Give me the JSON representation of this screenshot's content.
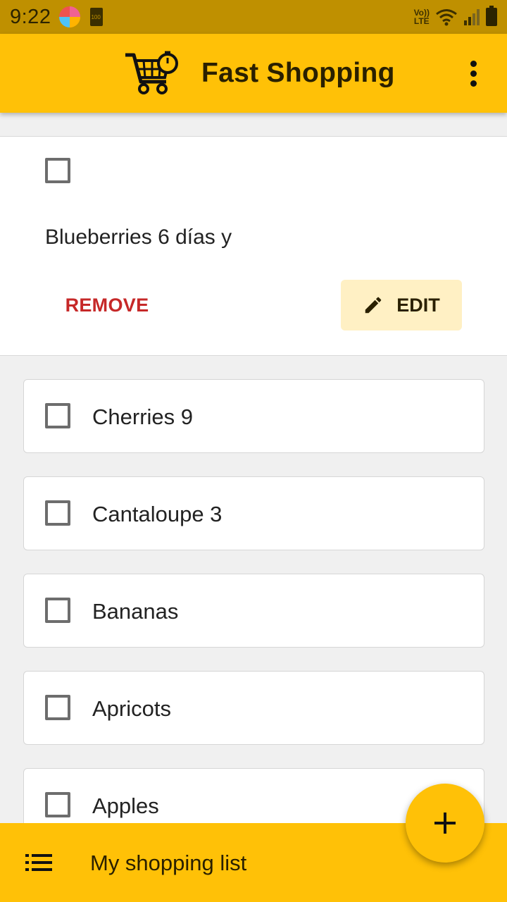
{
  "status_bar": {
    "time": "9:22",
    "notification_badge": "100",
    "network_label_top": "Vo))",
    "network_label_bottom": "LTE"
  },
  "app_bar": {
    "title": "Fast Shopping",
    "logo_icon": "cart-timer-icon",
    "menu_icon": "more-vert-icon"
  },
  "expanded_item": {
    "label": "Blueberries 6 días y",
    "checked": false,
    "remove_label": "REMOVE",
    "edit_label": "EDIT",
    "edit_icon": "pencil-icon"
  },
  "items": [
    {
      "label": "Cherries 9",
      "checked": false
    },
    {
      "label": "Cantaloupe 3",
      "checked": false
    },
    {
      "label": "Bananas",
      "checked": false
    },
    {
      "label": "Apricots",
      "checked": false
    },
    {
      "label": "Apples",
      "checked": false
    }
  ],
  "bottom_bar": {
    "title": "My shopping list",
    "icon": "list-icon"
  },
  "fab": {
    "icon": "plus-icon"
  },
  "colors": {
    "accent": "#ffc107",
    "status_bar": "#bf9000",
    "remove": "#c62828",
    "edit_bg": "#fff0c4"
  }
}
